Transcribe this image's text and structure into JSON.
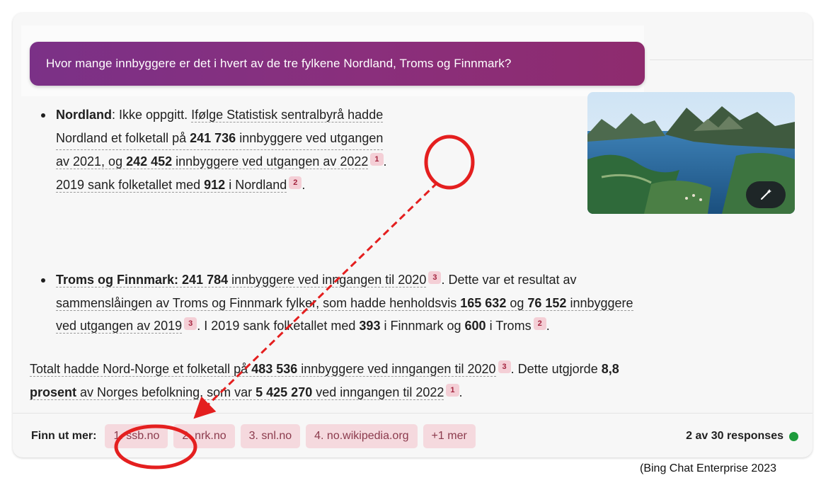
{
  "query": "Hvor mange innbyggere er det i hvert av de tre fylkene Nordland, Troms og Finnmark?",
  "answer": {
    "nordland": {
      "heading": "Nordland",
      "colon": ": ",
      "intro": "Ikke oppgitt. ",
      "line1": "Ifølge Statistisk sentralbyrå hadde",
      "line2a": "Nordland et folketall på ",
      "value1": "241 736",
      "line2b": " innbyggere ved utgangen",
      "line3a": "av 2021, og ",
      "value2": "242 452",
      "line3b": " innbyggere ved utgangen av 2022",
      "cite1": "1",
      "line3c": ".",
      "line4a": "2019 sank folketallet med ",
      "value3": "912",
      "line4b": " i Nordland",
      "cite2": "2",
      "line4c": "."
    },
    "troms": {
      "heading": "Troms og Finnmark",
      "colon": ": ",
      "value1": "241 784",
      "line1a": " innbyggere ved inngangen til 2020",
      "cite1": "3",
      "line1b": ". Dette var et resultat av",
      "line2a": "sammenslåingen av Troms og Finnmark fylker, som hadde henholdsvis ",
      "value2": "165 632",
      "line2b": " og ",
      "value3": "76 152",
      "line2c": " innbyggere",
      "line3a": "ved utgangen av 2019",
      "cite2": "3",
      "line3b": ". I 2019 sank folketallet med ",
      "value4": "393",
      "line3c": " i Finnmark og ",
      "value5": "600",
      "line3d": " i Troms",
      "cite3": "2",
      "line3e": "."
    },
    "total": {
      "line1a": "Totalt hadde Nord-Norge et folketall på ",
      "value1": "483 536",
      "line1b": " innbyggere ved inngangen til 2020",
      "cite1": "3",
      "line1c": ". Dette utgjorde ",
      "value2": "8,8",
      "value2b": "prosent",
      "line2a": " av Norges befolkning, som var ",
      "value3": "5 425 270",
      "line2b": " ved inngangen til 2022",
      "cite2": "1",
      "line2c": "."
    }
  },
  "image": {
    "icon": "magic-wand-icon"
  },
  "footer": {
    "label": "Finn ut mer:",
    "sources": [
      "1. ssb.no",
      "2. nrk.no",
      "3. snl.no",
      "4. no.wikipedia.org",
      "+1 mer"
    ],
    "responses": "2 av 30 responses",
    "status_color": "#1e9b3c"
  },
  "caption": "(Bing Chat Enterprise 2023",
  "annotation_color": "#e41f1f"
}
